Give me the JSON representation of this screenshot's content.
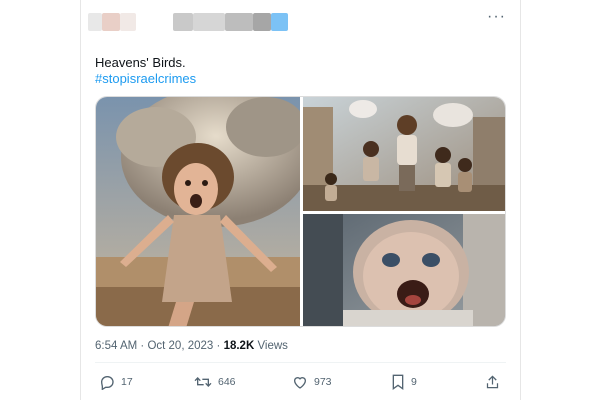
{
  "tweet": {
    "text": "Heavens' Birds.",
    "hashtag": "#stopisraelcrimes",
    "time": "6:54 AM",
    "date": "Oct 20, 2023",
    "separator": "·",
    "views_count": "18.2K",
    "views_label": "Views"
  },
  "actions": {
    "replies": "17",
    "reposts": "646",
    "likes": "973",
    "bookmarks": "9"
  },
  "colors": {
    "link": "#1d9bf0",
    "secondary_text": "#536471",
    "primary_text": "#0f1419"
  },
  "icons": [
    "more-icon",
    "reply-icon",
    "repost-icon",
    "like-icon",
    "bookmark-icon",
    "share-icon"
  ]
}
